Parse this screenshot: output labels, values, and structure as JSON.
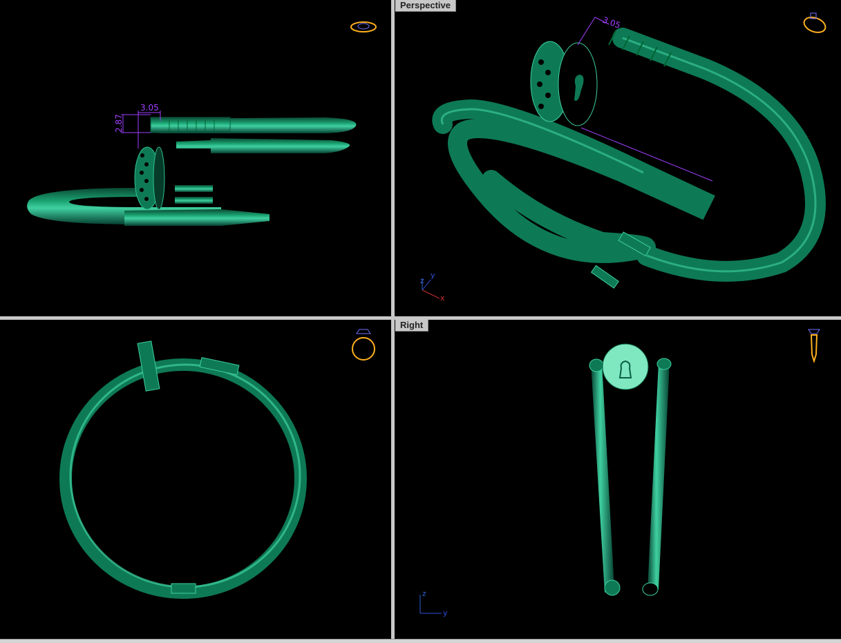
{
  "viewports": {
    "top": {
      "label": ""
    },
    "perspective": {
      "label": "Perspective"
    },
    "front": {
      "label": ""
    },
    "right": {
      "label": "Right"
    }
  },
  "dimensions": {
    "top_width": "3.05",
    "top_height": "2.87",
    "persp_width": "3.05"
  },
  "axes": {
    "perspective": {
      "z": "z",
      "y": "y",
      "x": "x"
    },
    "right": {
      "z": "z",
      "y": "y"
    }
  },
  "colors": {
    "viewport_bg": "#000000",
    "model": "#0e7a55",
    "model_highlight": "#3fd0a0",
    "dimension": "#a040ff",
    "nav_icon": "#ffb020",
    "axis_x": "#d03030",
    "axis_y": "#3050e0",
    "axis_z": "#3060d0"
  },
  "icons": {
    "top_nav": "ring-top-view-icon",
    "perspective_nav": "ring-perspective-icon",
    "front_nav": "ring-front-icon",
    "right_nav": "ring-side-icon"
  }
}
